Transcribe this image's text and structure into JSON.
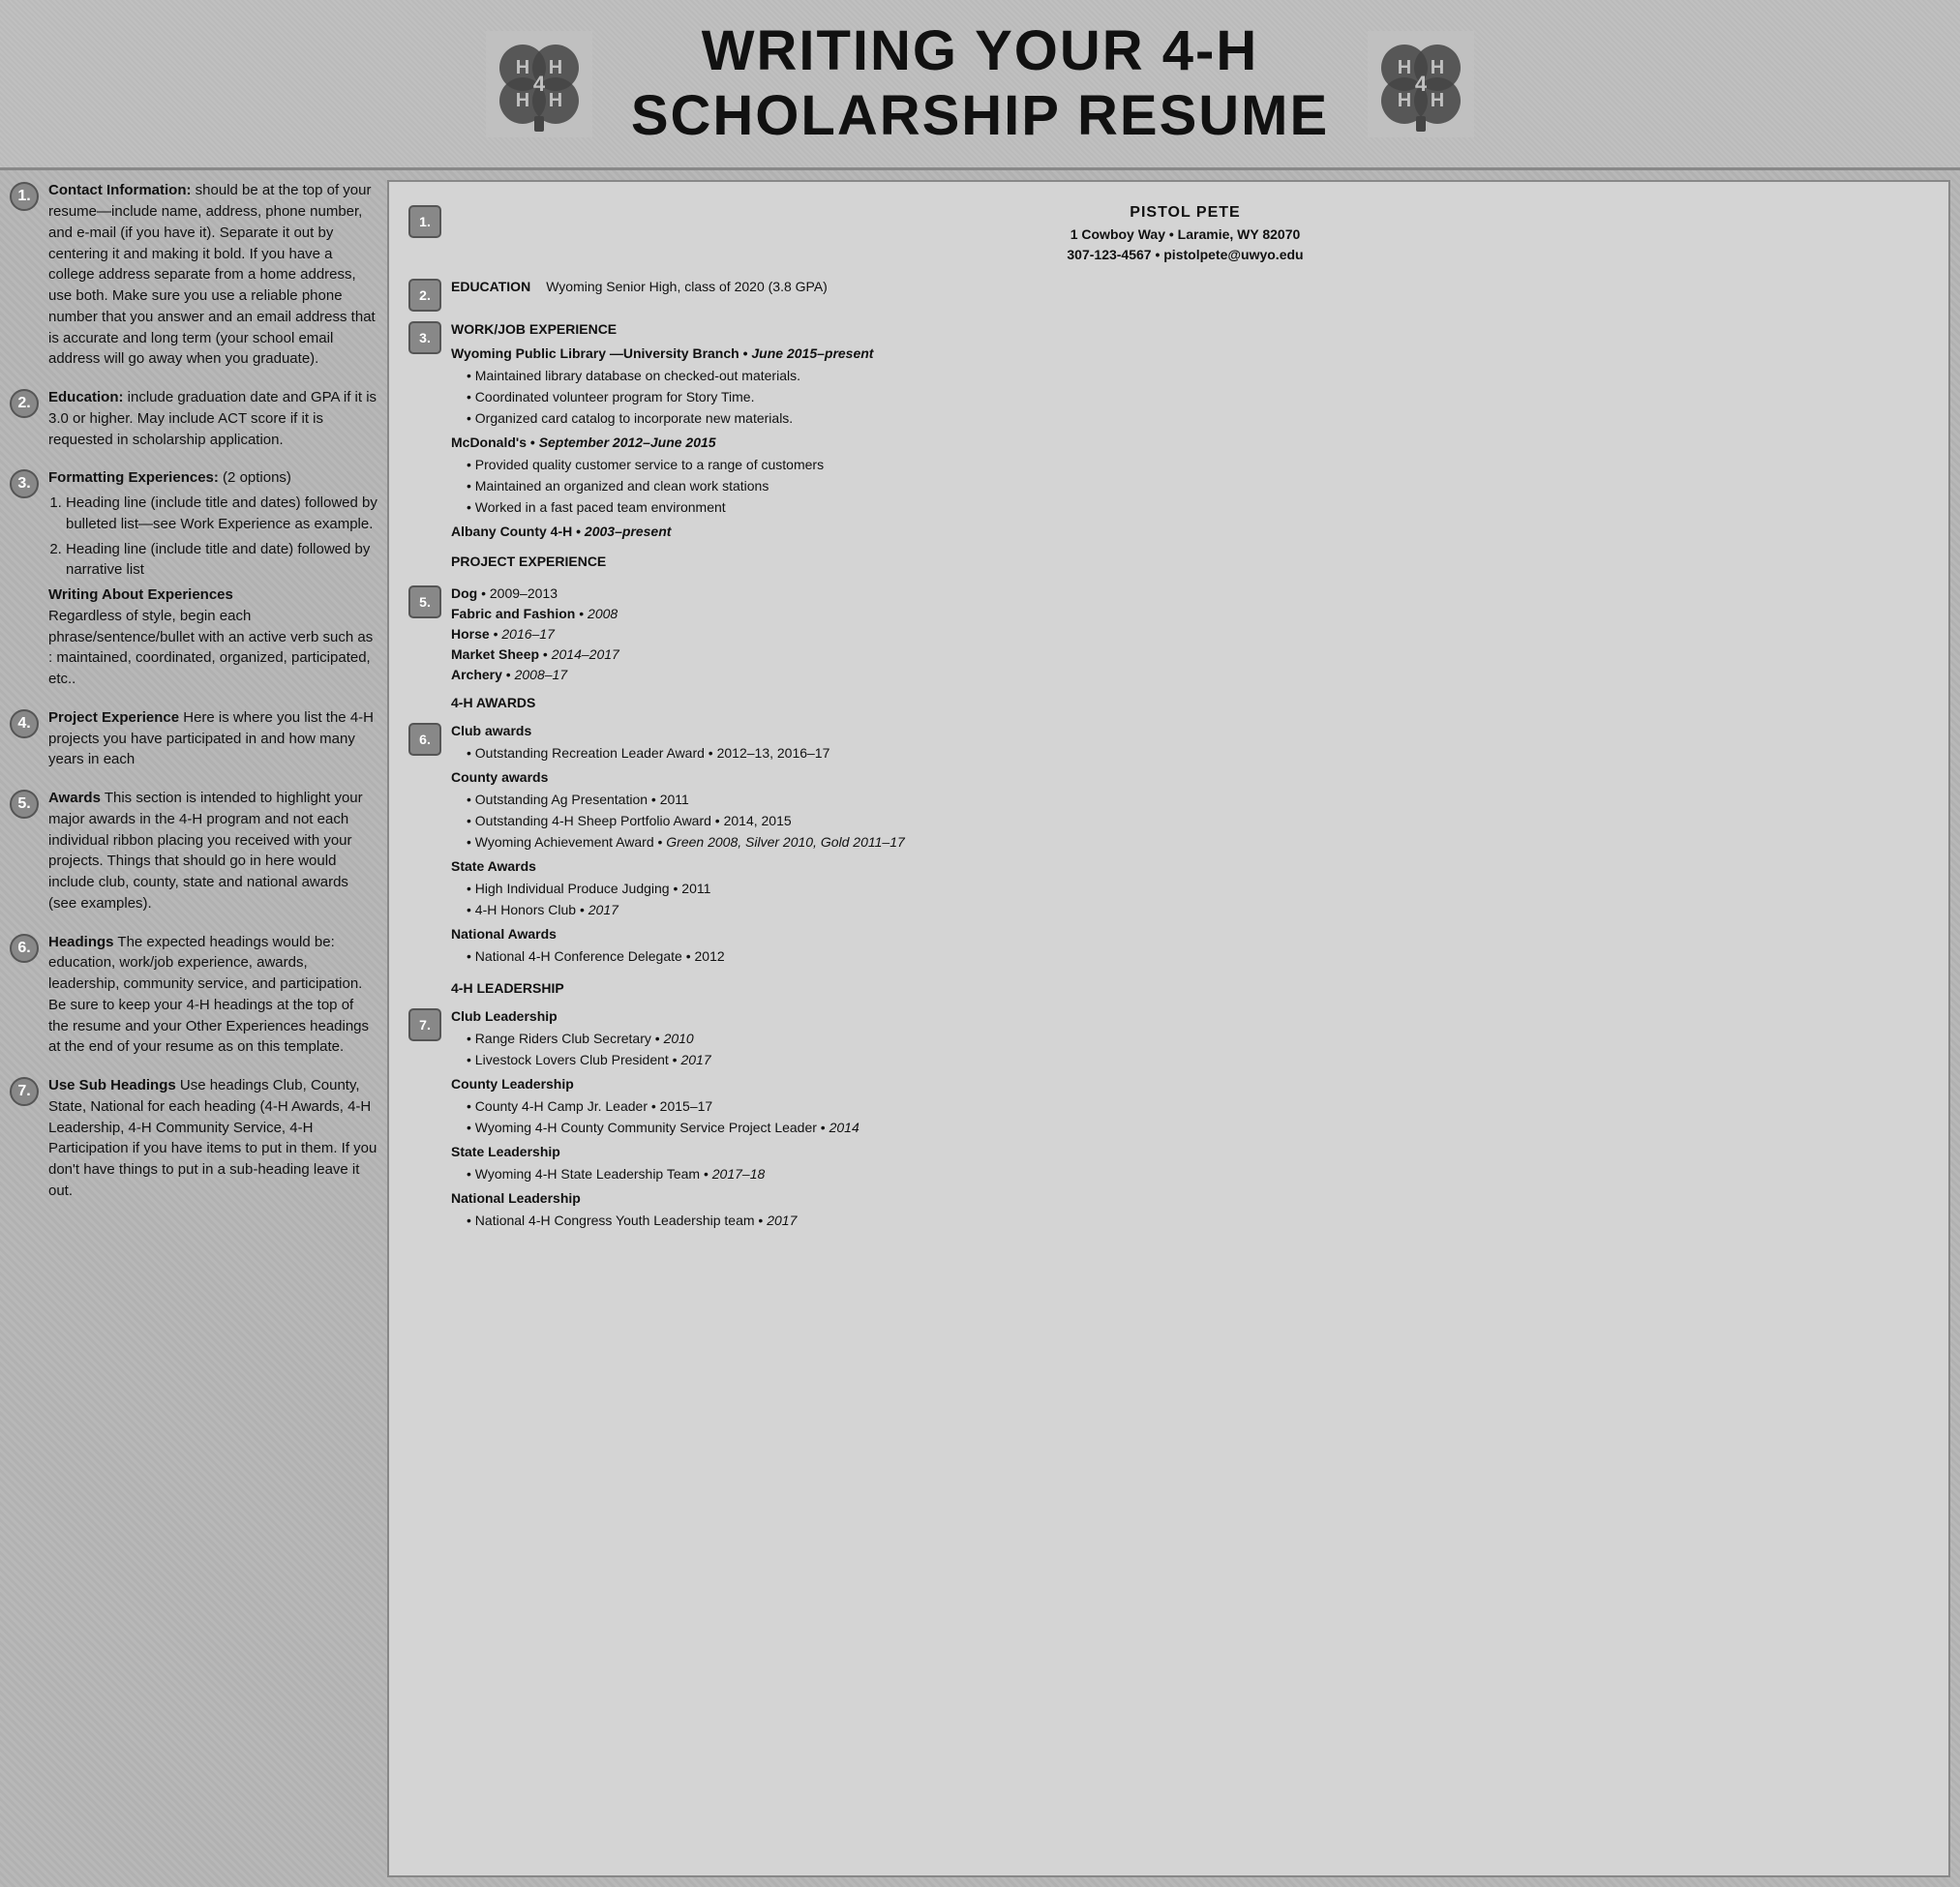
{
  "header": {
    "title_line1": "WRITING YOUR 4-H",
    "title_line2": "SCHOLARSHIP RESUME"
  },
  "instructions": [
    {
      "step": "1.",
      "bold": "Contact Information:",
      "text": " should be at the top of your resume—include name, address, phone number, and e-mail (if you have it). Separate it out by centering it and making it bold. If you have a college address separate from a home address, use both.  Make sure you use a reliable phone number that you answer and an email address that is accurate and long term (your school email address will go away when you graduate)."
    },
    {
      "step": "2.",
      "bold": "Education:",
      "text": " include graduation date and GPA if it is 3.0 or higher. May include ACT score if it is requested in scholarship application."
    },
    {
      "step": "3.",
      "bold": "Formatting Experiences:",
      "text": " (2 options)\n1. Heading line (include title and dates) followed by bulleted list—see Work Experience as example.\n2. Heading line (include title and date) followed by narrative list\nWriting About Experiences\nRegardless of style, begin each phrase/sentence/bullet with an active verb such as :  maintained, coordinated, organized, participated, etc.."
    },
    {
      "step": "4.",
      "bold": "Project Experience",
      "text": " Here is where you list the 4-H projects you have participated in and how many years in each"
    },
    {
      "step": "5.",
      "bold": "Awards",
      "text": " This section is intended to highlight your major awards in the 4-H program and not each individual ribbon placing you received with your projects. Things that should go in here would include club, county, state and national awards (see examples)."
    },
    {
      "step": "6.",
      "bold": "Headings",
      "text": " The expected headings would be: education, work/job experience, awards, leadership, community service, and participation. Be sure to keep your 4-H headings at the top of the resume and your Other Experiences headings at the end of your resume as on this template."
    },
    {
      "step": "7.",
      "bold": "Use Sub Headings",
      "text": " Use headings Club, County, State, National for each heading (4-H Awards, 4-H Leadership, 4-H Community Service, 4-H Participation if you have items to put in them. If you don't have things to put in a sub-heading leave it out."
    }
  ],
  "resume": {
    "contact": {
      "name": "PISTOL PETE",
      "address": "1 Cowboy Way • Laramie, WY  82070",
      "phone_email": "307-123-4567 • pistolpete@uwyo.edu"
    },
    "education": {
      "label": "EDUCATION",
      "value": "Wyoming Senior High, class of 2020 (3.8 GPA)"
    },
    "work_heading": "WORK/JOB EXPERIENCE",
    "work_entries": [
      {
        "employer": "Wyoming Public Library —University Branch",
        "dates": "June 2015–present",
        "bullets": [
          "Maintained library database on checked-out materials.",
          "Coordinated volunteer program for Story Time.",
          "Organized card catalog to incorporate new materials."
        ]
      },
      {
        "employer": "McDonald's",
        "dates": "September 2012–June 2015",
        "bullets": [
          "Provided quality customer service to a range of customers",
          "Maintained an organized and clean work stations",
          "Worked in a fast paced team environment"
        ]
      },
      {
        "employer": "Albany County 4-H",
        "dates": "2003–present",
        "bullets": []
      }
    ],
    "project_heading": "PROJECT EXPERIENCE",
    "projects": [
      "Dog • 2009–2013",
      "Fabric and Fashion • 2008",
      "Horse • 2016–17",
      "Market Sheep • 2014–2017",
      "Archery • 2008–17"
    ],
    "awards_heading": "4-H AWARDS",
    "awards": {
      "club": {
        "label": "Club awards",
        "items": [
          "Outstanding Recreation Leader Award • 2012–13,  2016–17"
        ]
      },
      "county": {
        "label": "County awards",
        "items": [
          "Outstanding Ag Presentation • 2011",
          "Outstanding 4-H Sheep Portfolio Award • 2014, 2015",
          "Wyoming Achievement Award • Green 2008, Silver 2010, Gold 2011–17"
        ]
      },
      "state": {
        "label": "State Awards",
        "items": [
          "High Individual Produce Judging • 2011",
          "4-H Honors Club • 2017"
        ]
      },
      "national": {
        "label": "National Awards",
        "items": [
          "National 4-H Conference Delegate • 2012"
        ]
      }
    },
    "leadership_heading": "4-H LEADERSHIP",
    "leadership": {
      "club": {
        "label": "Club Leadership",
        "items": [
          "Range Riders Club Secretary •  2010",
          "Livestock Lovers Club President • 2017"
        ]
      },
      "county": {
        "label": "County Leadership",
        "items": [
          "County 4-H Camp Jr. Leader • 2015–17",
          "Wyoming 4-H County Community Service Project Leader • 2014"
        ]
      },
      "state": {
        "label": "State Leadership",
        "items": [
          "Wyoming 4-H State Leadership Team • 2017–18"
        ]
      },
      "national": {
        "label": "National Leadership",
        "items": [
          "National 4-H Congress Youth Leadership team • 2017"
        ]
      }
    }
  }
}
